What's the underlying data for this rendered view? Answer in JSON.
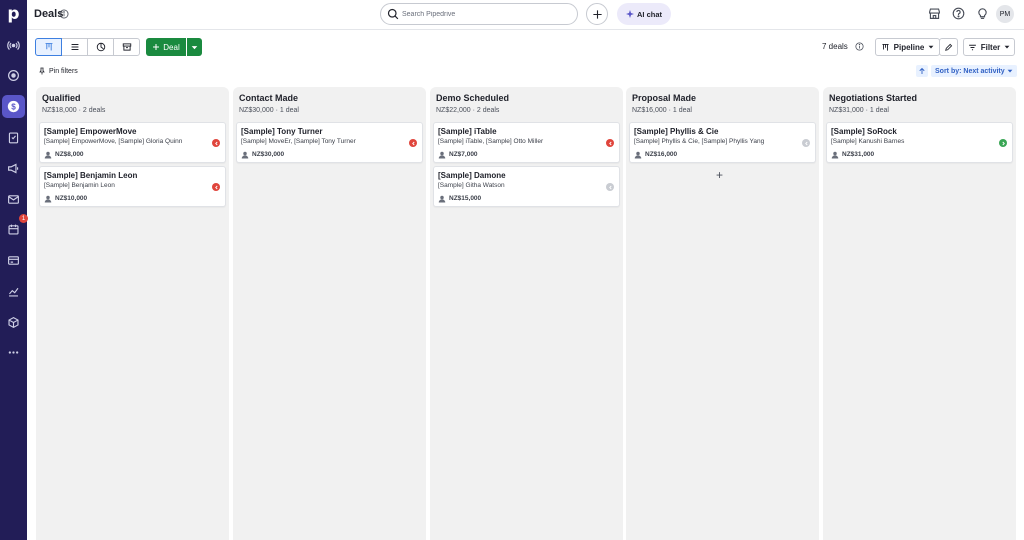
{
  "header": {
    "title": "Deals",
    "search_placeholder": "Search Pipedrive",
    "ai_chat_label": "AI chat",
    "avatar_initials": "PM"
  },
  "sidebar": {
    "logo": "p",
    "items": [
      {
        "name": "radio-icon"
      },
      {
        "name": "target-icon"
      },
      {
        "name": "dollar-icon"
      },
      {
        "name": "clipboard-icon"
      },
      {
        "name": "megaphone-icon"
      },
      {
        "name": "mail-icon"
      },
      {
        "name": "calendar-icon"
      },
      {
        "name": "card-icon"
      },
      {
        "name": "chart-icon"
      },
      {
        "name": "box-icon"
      },
      {
        "name": "more-icon"
      }
    ],
    "calendar_badge": "1"
  },
  "toolbar": {
    "deal_button_label": "Deal",
    "deal_count": "7 deals",
    "pipeline_label": "Pipeline",
    "filter_label": "Filter",
    "pin_filters_label": "Pin filters",
    "sort_label": "Sort by: Next activity"
  },
  "columns": [
    {
      "title": "Qualified",
      "summary": "NZ$18,000 · 2 deals",
      "deals": [
        {
          "title": "[Sample] EmpowerMove",
          "persons": "[Sample] EmpowerMove, [Sample] Gloria Quinn",
          "value": "NZ$8,000",
          "status": "overdue",
          "status_color": "#e0453c"
        },
        {
          "title": "[Sample] Benjamin Leon",
          "persons": "[Sample] Benjamin Leon",
          "value": "NZ$10,000",
          "status": "overdue",
          "status_color": "#e0453c"
        }
      ]
    },
    {
      "title": "Contact Made",
      "summary": "NZ$30,000 · 1 deal",
      "deals": [
        {
          "title": "[Sample] Tony Turner",
          "persons": "[Sample] MoveEr, [Sample] Tony Turner",
          "value": "NZ$30,000",
          "status": "overdue",
          "status_color": "#e0453c"
        }
      ]
    },
    {
      "title": "Demo Scheduled",
      "summary": "NZ$22,000 · 2 deals",
      "deals": [
        {
          "title": "[Sample] iTable",
          "persons": "[Sample] iTable, [Sample] Otto Miller",
          "value": "NZ$7,000",
          "status": "overdue",
          "status_color": "#e0453c"
        },
        {
          "title": "[Sample] Damone",
          "persons": "[Sample] Githa Watson",
          "value": "NZ$15,000",
          "status": "none",
          "status_color": "#c9ccd2"
        }
      ]
    },
    {
      "title": "Proposal Made",
      "summary": "NZ$16,000 · 1 deal",
      "deals": [
        {
          "title": "[Sample] Phyllis & Cie",
          "persons": "[Sample] Phyllis & Cie, [Sample] Phyllis Yang",
          "value": "NZ$16,000",
          "status": "none",
          "status_color": "#c9ccd2"
        }
      ],
      "add_symbol": "+"
    },
    {
      "title": "Negotiations Started",
      "summary": "NZ$31,000 · 1 deal",
      "deals": [
        {
          "title": "[Sample] SoRock",
          "persons": "[Sample] Kanushi Barnes",
          "value": "NZ$31,000",
          "status": "scheduled",
          "status_color": "#3aa655"
        }
      ]
    }
  ],
  "colors": {
    "sidebar": "#221d57",
    "sidebar_active": "#5a56c8",
    "primary_green": "#1a8a3f",
    "column_bg": "#f1f1f1",
    "overdue_red": "#e0453c",
    "scheduled_green": "#3aa655",
    "link_blue": "#3161c4"
  }
}
